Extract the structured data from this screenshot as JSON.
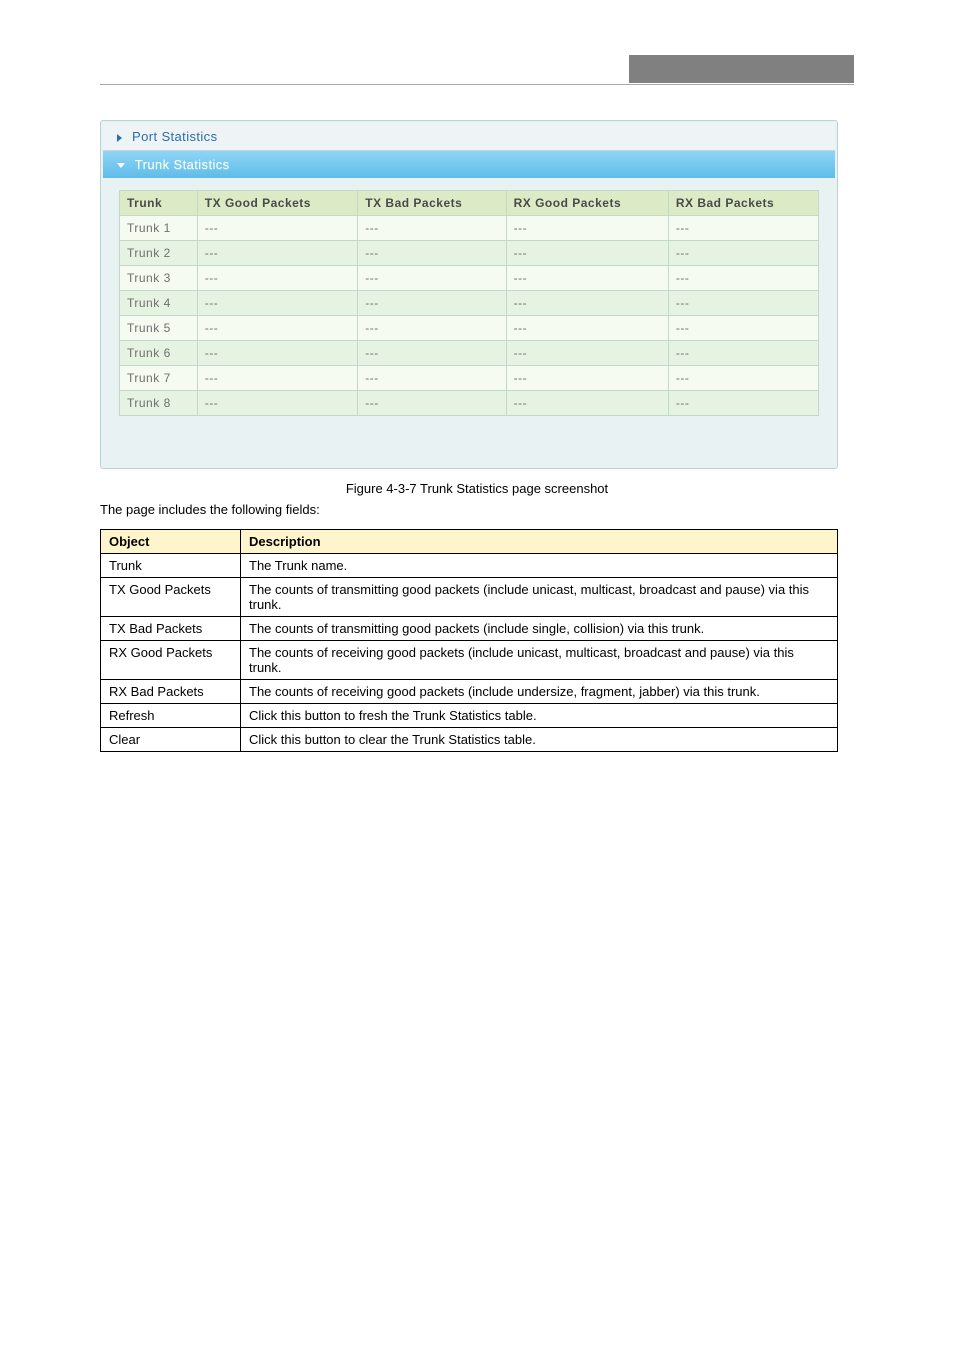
{
  "header": {
    "right_label": ""
  },
  "sections": {
    "port_title": "Port Statistics",
    "trunk_title": "Trunk Statistics"
  },
  "trunk_table": {
    "headers": [
      "Trunk",
      "TX Good Packets",
      "TX Bad Packets",
      "RX Good Packets",
      "RX Bad Packets"
    ],
    "rows": [
      [
        "Trunk 1",
        "---",
        "---",
        "---",
        "---"
      ],
      [
        "Trunk 2",
        "---",
        "---",
        "---",
        "---"
      ],
      [
        "Trunk 3",
        "---",
        "---",
        "---",
        "---"
      ],
      [
        "Trunk 4",
        "---",
        "---",
        "---",
        "---"
      ],
      [
        "Trunk 5",
        "---",
        "---",
        "---",
        "---"
      ],
      [
        "Trunk 6",
        "---",
        "---",
        "---",
        "---"
      ],
      [
        "Trunk 7",
        "---",
        "---",
        "---",
        "---"
      ],
      [
        "Trunk 8",
        "---",
        "---",
        "---",
        "---"
      ]
    ]
  },
  "figure": {
    "caption": "Figure 4-3-7 Trunk Statistics page screenshot",
    "intro": "The page includes the following fields:"
  },
  "desc_table": {
    "headers": [
      "Object",
      "Description"
    ],
    "rows": [
      [
        "Trunk",
        "The Trunk name."
      ],
      [
        "TX Good Packets",
        "The counts of transmitting good packets (include unicast, multicast, broadcast and pause) via this trunk."
      ],
      [
        "TX Bad Packets",
        "The counts of transmitting good packets (include single, collision) via this trunk."
      ],
      [
        "RX Good Packets",
        "The counts of receiving good packets (include unicast, multicast, broadcast and pause) via this trunk."
      ],
      [
        "RX Bad Packets",
        "The counts of receiving good packets (include undersize, fragment, jabber) via this trunk."
      ],
      [
        "Refresh",
        "Click this button to fresh the Trunk Statistics table."
      ],
      [
        "Clear",
        "Click this button to clear the Trunk Statistics table."
      ]
    ]
  },
  "footer_note": ""
}
